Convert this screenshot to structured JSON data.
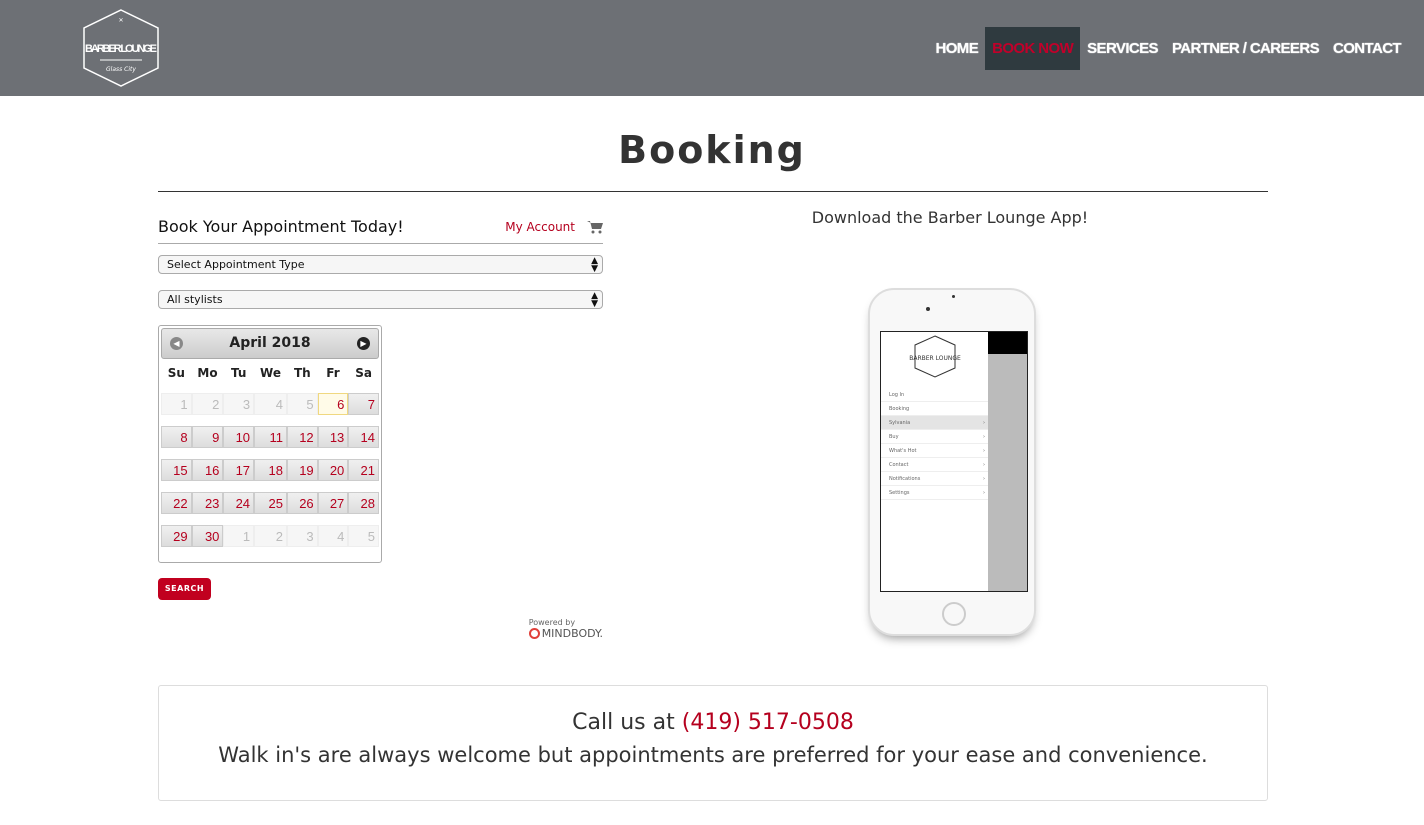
{
  "header": {
    "logo_text": "BARBER LOUNGE",
    "logo_sub": "Glass City",
    "nav": [
      {
        "label": "HOME",
        "active": false
      },
      {
        "label": "BOOK NOW",
        "active": true
      },
      {
        "label": "SERVICES",
        "active": false
      },
      {
        "label": "PARTNER / CAREERS",
        "active": false
      },
      {
        "label": "CONTACT",
        "active": false
      }
    ]
  },
  "page_title": "Booking",
  "booking": {
    "heading": "Book Your Appointment Today!",
    "my_account": "My Account",
    "cart_icon": "cart-icon",
    "appointment_type": "Select Appointment Type",
    "stylist": "All stylists",
    "calendar": {
      "month": "April 2018",
      "days": [
        "Su",
        "Mo",
        "Tu",
        "We",
        "Th",
        "Fr",
        "Sa"
      ],
      "today": 6,
      "weeks": [
        [
          [
            "1",
            1
          ],
          [
            "2",
            1
          ],
          [
            "3",
            1
          ],
          [
            "4",
            1
          ],
          [
            "5",
            1
          ],
          [
            "6",
            0
          ],
          [
            "7",
            0
          ]
        ],
        [
          [
            "8",
            0
          ],
          [
            "9",
            0
          ],
          [
            "10",
            0
          ],
          [
            "11",
            0
          ],
          [
            "12",
            0
          ],
          [
            "13",
            0
          ],
          [
            "14",
            0
          ]
        ],
        [
          [
            "15",
            0
          ],
          [
            "16",
            0
          ],
          [
            "17",
            0
          ],
          [
            "18",
            0
          ],
          [
            "19",
            0
          ],
          [
            "20",
            0
          ],
          [
            "21",
            0
          ]
        ],
        [
          [
            "22",
            0
          ],
          [
            "23",
            0
          ],
          [
            "24",
            0
          ],
          [
            "25",
            0
          ],
          [
            "26",
            0
          ],
          [
            "27",
            0
          ],
          [
            "28",
            0
          ]
        ],
        [
          [
            "29",
            0
          ],
          [
            "30",
            0
          ],
          [
            "1",
            1
          ],
          [
            "2",
            1
          ],
          [
            "3",
            1
          ],
          [
            "4",
            1
          ],
          [
            "5",
            1
          ]
        ]
      ]
    },
    "search_label": "SEARCH",
    "powered_by": "Powered by",
    "mindbody": "MINDBODY."
  },
  "app": {
    "heading": "Download the Barber Lounge App!",
    "menu": [
      {
        "label": "Log In"
      },
      {
        "label": "Booking"
      },
      {
        "label": "Sylvania"
      },
      {
        "label": "Buy"
      },
      {
        "label": "What's Hot"
      },
      {
        "label": "Contact"
      },
      {
        "label": "Notifications"
      },
      {
        "label": "Settings"
      }
    ]
  },
  "footer_box": {
    "call_prefix": "Call us at",
    "phone": "(419) 517-0508",
    "walk_in": "Walk in's are always welcome but appointments are preferred for your ease and convenience."
  },
  "colors": {
    "header_bg": "#6d7075",
    "accent": "#c1002a",
    "nav_active_bg": "#2f3a3f"
  }
}
